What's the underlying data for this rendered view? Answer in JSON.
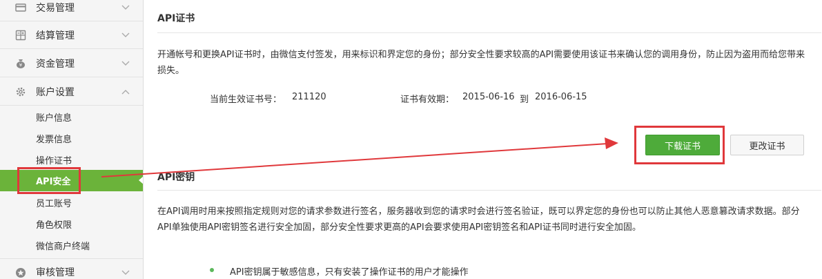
{
  "sidebar": {
    "groups": [
      {
        "label": "交易管理",
        "icon": "card-icon"
      },
      {
        "label": "结算管理",
        "icon": "calculator-icon"
      },
      {
        "label": "资金管理",
        "icon": "money-bag-icon"
      },
      {
        "label": "账户设置",
        "icon": "gear-icon"
      },
      {
        "label": "审核管理",
        "icon": "star-icon"
      }
    ],
    "account_items": [
      {
        "label": "账户信息"
      },
      {
        "label": "发票信息"
      },
      {
        "label": "操作证书"
      },
      {
        "label": "API安全"
      },
      {
        "label": "员工账号"
      },
      {
        "label": "角色权限"
      },
      {
        "label": "微信商户终端"
      }
    ],
    "active_item": "API安全"
  },
  "cert": {
    "title": "API证书",
    "description": "开通帐号和更换API证书时，由微信支付签发，用来标识和界定您的身份；部分安全性要求较高的API需要使用该证书来确认您的调用身份，防止因为盗用而给您带来损失。",
    "serial_label": "当前生效证书号：",
    "serial_value": "211120",
    "validity_label": "证书有效期：",
    "validity_from": "2015-06-16",
    "validity_to_word": "到",
    "validity_to": "2016-06-15",
    "download_button": "下载证书",
    "change_button": "更改证书"
  },
  "apikey": {
    "title": "API密钥",
    "description": "在API调用时用来按照指定规则对您的请求参数进行签名，服务器收到您的请求时会进行签名验证，既可以界定您的身份也可以防止其他人恶意篡改请求数据。部分API单独使用API密钥签名进行安全加固，部分安全性要求更高的API会要求使用API密钥签名和API证书同时进行安全加固。",
    "bullets": [
      "API密钥属于敏感信息，只有安装了操作证书的用户才能操作"
    ]
  },
  "colors": {
    "active_green": "#6bb33a",
    "button_green": "#4eab3a",
    "annotation_red": "#e0383b"
  }
}
